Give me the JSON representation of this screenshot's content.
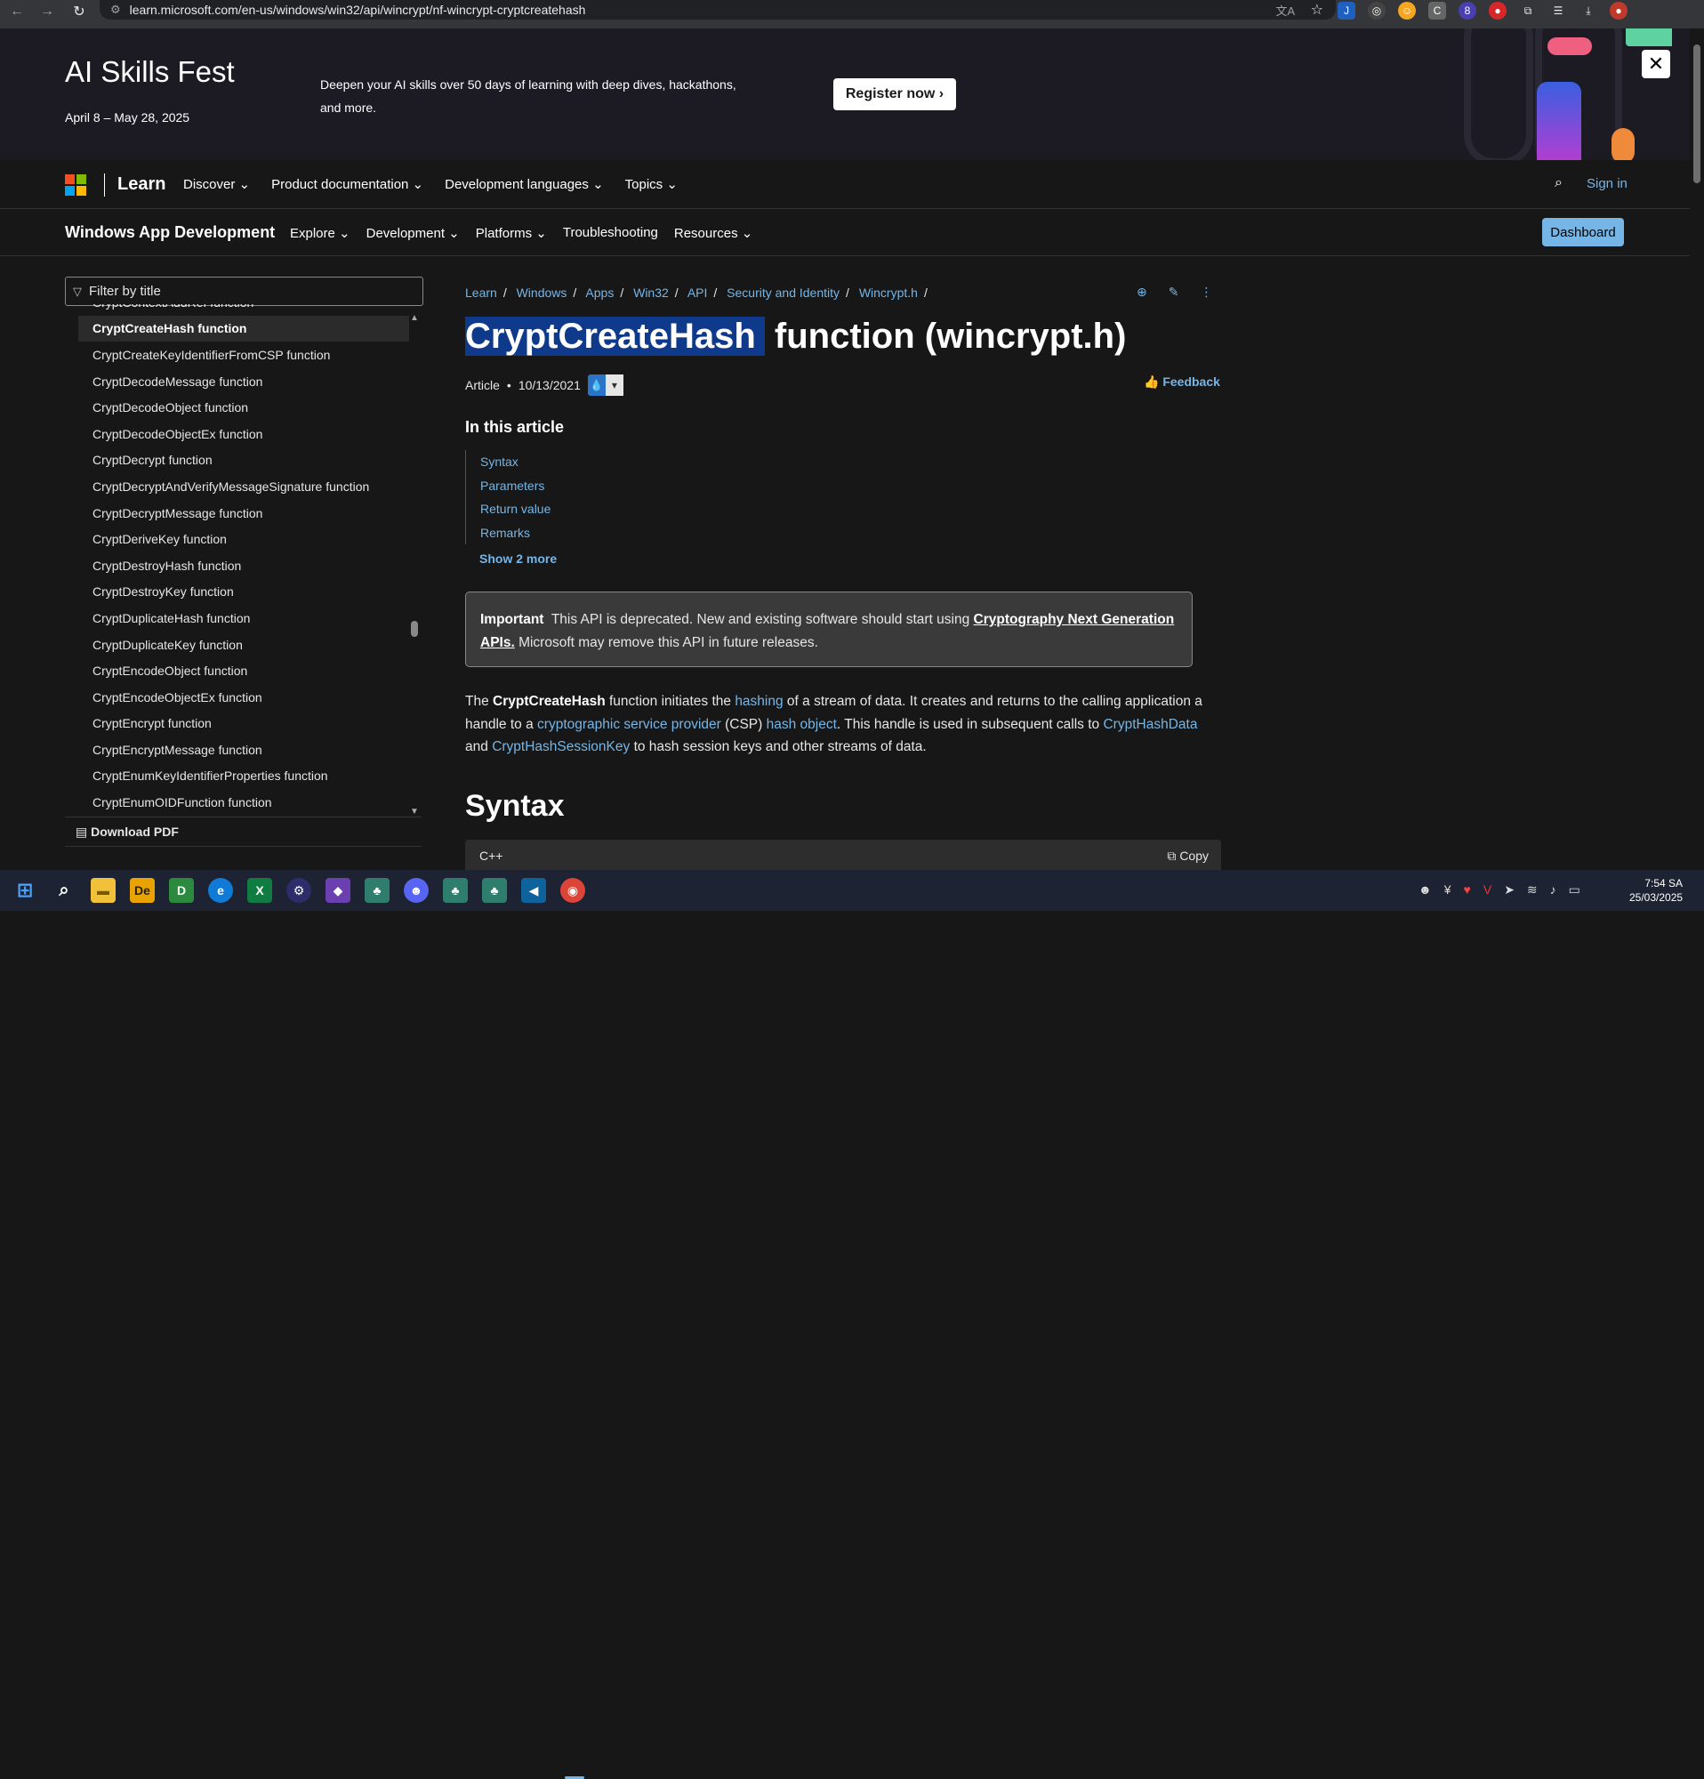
{
  "browser": {
    "url": "learn.microsoft.com/en-us/windows/win32/api/wincrypt/nf-wincrypt-cryptcreatehash"
  },
  "banner": {
    "title": "AI Skills Fest",
    "dates": "April 8 – May 28, 2025",
    "description": "Deepen your AI skills over 50 days of learning with deep dives, hackathons, and more.",
    "cta": "Register now"
  },
  "nav": {
    "brand": "Learn",
    "menu": [
      "Discover",
      "Product documentation",
      "Development languages",
      "Topics"
    ],
    "signin": "Sign in"
  },
  "subnav": {
    "title": "Windows App Development",
    "menu": [
      "Explore",
      "Development",
      "Platforms",
      "Troubleshooting",
      "Resources"
    ],
    "dashboard": "Dashboard"
  },
  "sidebar": {
    "filter_placeholder": "Filter by title",
    "items": [
      "CryptContextAddRef function",
      "CryptCreateHash function",
      "CryptCreateKeyIdentifierFromCSP function",
      "CryptDecodeMessage function",
      "CryptDecodeObject function",
      "CryptDecodeObjectEx function",
      "CryptDecrypt function",
      "CryptDecryptAndVerifyMessageSignature function",
      "CryptDecryptMessage function",
      "CryptDeriveKey function",
      "CryptDestroyHash function",
      "CryptDestroyKey function",
      "CryptDuplicateHash function",
      "CryptDuplicateKey function",
      "CryptEncodeObject function",
      "CryptEncodeObjectEx function",
      "CryptEncrypt function",
      "CryptEncryptMessage function",
      "CryptEnumKeyIdentifierProperties function",
      "CryptEnumOIDFunction function"
    ],
    "download_pdf": "Download PDF"
  },
  "breadcrumb": [
    "Learn",
    "Windows",
    "Apps",
    "Win32",
    "API",
    "Security and Identity",
    "Wincrypt.h"
  ],
  "article": {
    "title_highlight": "CryptCreateHash",
    "title_rest": " function (wincrypt.h)",
    "type": "Article",
    "date": "10/13/2021",
    "feedback": "Feedback",
    "in_this_article": "In this article",
    "toc": [
      "Syntax",
      "Parameters",
      "Return value",
      "Remarks"
    ],
    "show_more": "Show 2 more",
    "important_label": "Important",
    "important_text": "This API is deprecated. New and existing software should start using",
    "important_link": "Cryptography Next Generation APIs.",
    "important_tail": "Microsoft may remove this API in future releases.",
    "p1": "The",
    "p_bold": "CryptCreateHash",
    "p2": "function initiates the",
    "link_hashing": "hashing",
    "p3": "of a stream of data. It creates and returns to the calling application a handle to a",
    "link_csp": "cryptographic service provider",
    "p4": "(CSP)",
    "link_hashobj": "hash object",
    "p5": ". This handle is used in subsequent calls to",
    "link_hashdata": "CryptHashData",
    "p6": "and",
    "link_hsk": "CryptHashSessionKey",
    "p7": "to hash session keys and other streams of data.",
    "syntax_heading": "Syntax",
    "code_lang": "C++",
    "copy": "Copy"
  },
  "taskbar": {
    "time": "7:54 SA",
    "date": "25/03/2025"
  }
}
